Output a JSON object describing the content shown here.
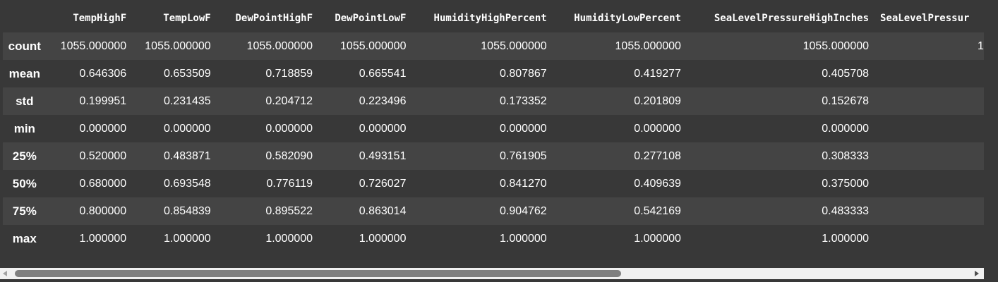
{
  "table": {
    "columns": [
      "TempHighF",
      "TempLowF",
      "DewPointHighF",
      "DewPointLowF",
      "HumidityHighPercent",
      "HumidityLowPercent",
      "SeaLevelPressureHighInches",
      "SeaLevelPressur"
    ],
    "rows": [
      {
        "label": "count",
        "values": [
          "1055.000000",
          "1055.000000",
          "1055.000000",
          "1055.000000",
          "1055.000000",
          "1055.000000",
          "1055.000000",
          "1"
        ]
      },
      {
        "label": "mean",
        "values": [
          "0.646306",
          "0.653509",
          "0.718859",
          "0.665541",
          "0.807867",
          "0.419277",
          "0.405708",
          ""
        ]
      },
      {
        "label": "std",
        "values": [
          "0.199951",
          "0.231435",
          "0.204712",
          "0.223496",
          "0.173352",
          "0.201809",
          "0.152678",
          ""
        ]
      },
      {
        "label": "min",
        "values": [
          "0.000000",
          "0.000000",
          "0.000000",
          "0.000000",
          "0.000000",
          "0.000000",
          "0.000000",
          ""
        ]
      },
      {
        "label": "25%",
        "values": [
          "0.520000",
          "0.483871",
          "0.582090",
          "0.493151",
          "0.761905",
          "0.277108",
          "0.308333",
          ""
        ]
      },
      {
        "label": "50%",
        "values": [
          "0.680000",
          "0.693548",
          "0.776119",
          "0.726027",
          "0.841270",
          "0.409639",
          "0.375000",
          ""
        ]
      },
      {
        "label": "75%",
        "values": [
          "0.800000",
          "0.854839",
          "0.895522",
          "0.863014",
          "0.904762",
          "0.542169",
          "0.483333",
          ""
        ]
      },
      {
        "label": "max",
        "values": [
          "1.000000",
          "1.000000",
          "1.000000",
          "1.000000",
          "1.000000",
          "1.000000",
          "1.000000",
          ""
        ]
      }
    ]
  },
  "scrollbar": {
    "position": 0,
    "visible_fraction": 0.62
  },
  "colors": {
    "background": "#383838",
    "row_odd": "#444444",
    "text": "#ffffff",
    "scrollbar_track": "#f1f1f1",
    "scrollbar_thumb": "#7f7f7f"
  },
  "icons": {
    "scroll_left": "scroll-left-arrow-icon",
    "scroll_right": "scroll-right-arrow-icon"
  }
}
